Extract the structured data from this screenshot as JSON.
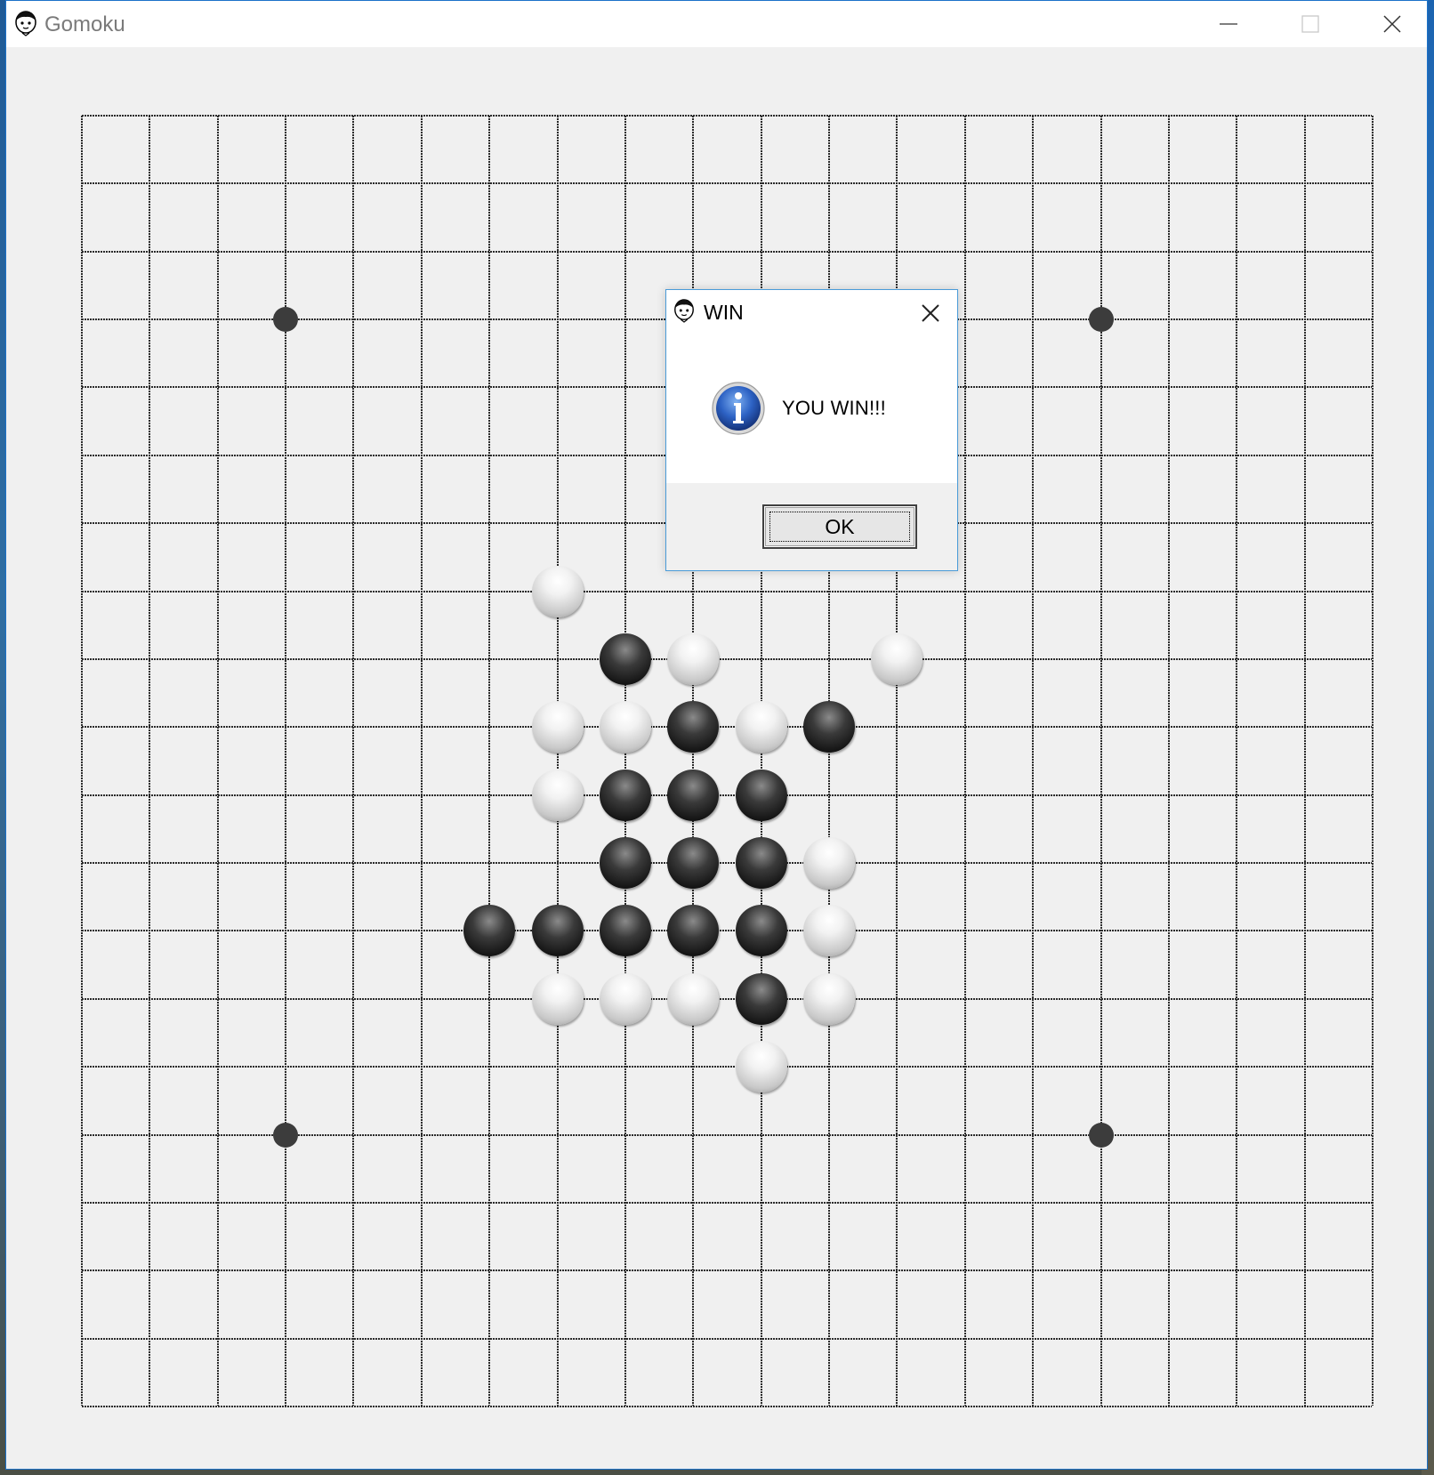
{
  "window": {
    "title": "Gomoku",
    "icon": "gomoku-face-icon",
    "controls": [
      "minimize-icon",
      "maximize-icon",
      "close-icon"
    ]
  },
  "board": {
    "size": 19,
    "line_color": "#2a2a2a",
    "background": "#f0f0f0",
    "star_points": [
      [
        3,
        3
      ],
      [
        15,
        3
      ],
      [
        3,
        15
      ],
      [
        15,
        15
      ]
    ],
    "stones": [
      {
        "col": 7,
        "row": 7,
        "color": "white"
      },
      {
        "col": 8,
        "row": 8,
        "color": "black"
      },
      {
        "col": 9,
        "row": 8,
        "color": "white"
      },
      {
        "col": 12,
        "row": 8,
        "color": "white"
      },
      {
        "col": 7,
        "row": 9,
        "color": "white"
      },
      {
        "col": 8,
        "row": 9,
        "color": "white"
      },
      {
        "col": 9,
        "row": 9,
        "color": "black"
      },
      {
        "col": 10,
        "row": 9,
        "color": "white"
      },
      {
        "col": 11,
        "row": 9,
        "color": "black"
      },
      {
        "col": 7,
        "row": 10,
        "color": "white"
      },
      {
        "col": 8,
        "row": 10,
        "color": "black"
      },
      {
        "col": 9,
        "row": 10,
        "color": "black"
      },
      {
        "col": 10,
        "row": 10,
        "color": "black"
      },
      {
        "col": 8,
        "row": 11,
        "color": "black"
      },
      {
        "col": 9,
        "row": 11,
        "color": "black"
      },
      {
        "col": 10,
        "row": 11,
        "color": "black"
      },
      {
        "col": 11,
        "row": 11,
        "color": "white"
      },
      {
        "col": 6,
        "row": 12,
        "color": "black"
      },
      {
        "col": 7,
        "row": 12,
        "color": "black"
      },
      {
        "col": 8,
        "row": 12,
        "color": "black"
      },
      {
        "col": 9,
        "row": 12,
        "color": "black"
      },
      {
        "col": 10,
        "row": 12,
        "color": "black"
      },
      {
        "col": 11,
        "row": 12,
        "color": "white"
      },
      {
        "col": 7,
        "row": 13,
        "color": "white"
      },
      {
        "col": 8,
        "row": 13,
        "color": "white"
      },
      {
        "col": 9,
        "row": 13,
        "color": "white"
      },
      {
        "col": 10,
        "row": 13,
        "color": "black"
      },
      {
        "col": 11,
        "row": 13,
        "color": "white"
      },
      {
        "col": 10,
        "row": 14,
        "color": "white"
      }
    ]
  },
  "dialog": {
    "title": "WIN",
    "icon": "gomoku-face-icon",
    "message_icon": "info-icon",
    "message": "YOU WIN!!!",
    "ok_label": "OK"
  }
}
